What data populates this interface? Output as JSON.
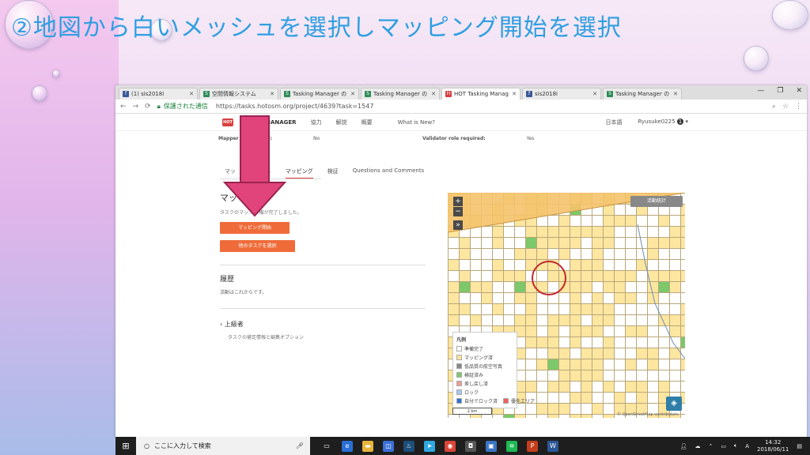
{
  "slide": {
    "title": "②地図から白いメッシュを選択しマッピング開始を選択"
  },
  "browser": {
    "tabs": [
      {
        "label": "(1) sis2018i",
        "favicon": "facebook-icon",
        "color": "#3b5998"
      },
      {
        "label": "空間情報システム",
        "favicon": "sj-icon",
        "color": "#2e8b57"
      },
      {
        "label": "Tasking Manager の",
        "favicon": "sj-icon",
        "color": "#2e8b57"
      },
      {
        "label": "Tasking Manager の",
        "favicon": "sj-icon",
        "color": "#2e8b57"
      },
      {
        "label": "HOT Tasking Manag",
        "favicon": "hot-icon",
        "color": "#d73f3f"
      },
      {
        "label": "sis2018i",
        "favicon": "facebook-icon",
        "color": "#3b5998"
      },
      {
        "label": "Tasking Manager の",
        "favicon": "sj-icon",
        "color": "#2e8b57"
      }
    ],
    "active_tab": 4,
    "secure_label": "保護された通信",
    "url": "https://tasks.hotosm.org/project/4639?task=1547"
  },
  "site": {
    "logo": "MANAGER",
    "nav": [
      "協力",
      "解説",
      "概要",
      "What is New?"
    ],
    "language": "日本語",
    "user": "Ryusuke0225",
    "user_badge": "1",
    "info_left_label": "Mapper ... required:",
    "info_left_value": "No",
    "info_right_label": "Validator role required:",
    "info_right_value": "Yes"
  },
  "subtabs": [
    "マッ",
    "...",
    "マッピング",
    "検証",
    "Questions and Comments"
  ],
  "panel": {
    "heading": "マッ",
    "note": "タスクのマッ... 準備が完了しました。",
    "start_mapping": "マッピング開始",
    "select_other": "他のタスクを選択",
    "history_heading": "履歴",
    "history_note": "活動はこれからです。",
    "advanced_heading": "上級者",
    "advanced_note": "タスクの補足情報と編集オプション"
  },
  "map": {
    "stats_button": "活動統計",
    "zoom_in": "+",
    "zoom_out": "−",
    "expand": "»",
    "legend_title": "凡例",
    "legend_items": [
      {
        "label": "準備完了",
        "color": "#ffffff"
      },
      {
        "label": "マッピング済",
        "color": "#fde79a"
      },
      {
        "label": "低品質の航空写真",
        "color": "#888888"
      },
      {
        "label": "検証済み",
        "color": "#7cc86a"
      },
      {
        "label": "差し戻し済",
        "color": "#f29a9a"
      },
      {
        "label": "ロック",
        "color": "#a9c4f2"
      },
      {
        "label": "自分でロック済",
        "color": "#2c6fd6"
      },
      {
        "label": "優先エリア",
        "color": "#f06060"
      }
    ],
    "scale_label": "2 km",
    "credit": "© OpenStreetMap contributors"
  },
  "taskbar": {
    "search_placeholder": "ここに入力して検索",
    "time": "14:32",
    "date": "2018/06/11"
  }
}
